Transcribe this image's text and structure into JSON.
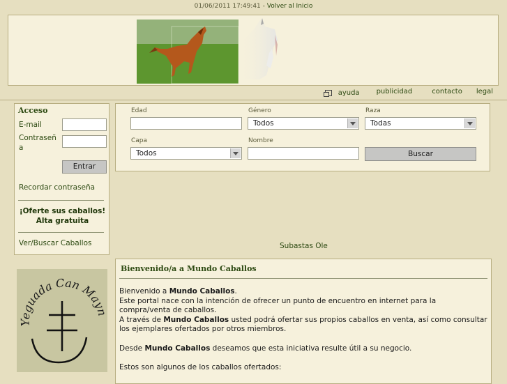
{
  "header": {
    "datetime": "01/06/2011 17:49:41",
    "separator": "-",
    "home_link": "Volver al Inicio"
  },
  "nav": {
    "help": "ayuda",
    "advertising": "publicidad",
    "contact": "contacto",
    "legal": "legal"
  },
  "login": {
    "title": "Acceso",
    "email_label": "E-mail",
    "password_label": "Contraseña",
    "submit": "Entrar",
    "remember": "Recordar contraseña",
    "offer_line1": "¡Oferte sus caballos!",
    "offer_line2": "Alta gratuita",
    "browse": "Ver/Buscar Caballos"
  },
  "search": {
    "age_label": "Edad",
    "gender_label": "Género",
    "gender_value": "Todos",
    "breed_label": "Raza",
    "breed_value": "Todas",
    "coat_label": "Capa",
    "coat_value": "Todos",
    "name_label": "Nombre",
    "submit": "Buscar"
  },
  "subastas_link": "Subastas Ole",
  "logo_text": "Yeguada Can Maynou",
  "welcome": {
    "title": "Bienvenido/a a Mundo Caballos",
    "p1_a": "Bienvenido a ",
    "brand": "Mundo Caballos",
    "p1_b": ".",
    "p2": "Este portal nace con la intención de ofrecer un punto de encuentro en internet para la compra/venta de caballos.",
    "p3_a": "A través de ",
    "p3_b": " usted podrá ofertar sus propios caballos en venta, así como consultar los ejemplares ofertados por otros miembros.",
    "p4_a": "Desde ",
    "p4_b": " deseamos que esta iniciativa resulte útil a su negocio.",
    "p5": "Estos son algunos de los caballos ofertados:"
  }
}
